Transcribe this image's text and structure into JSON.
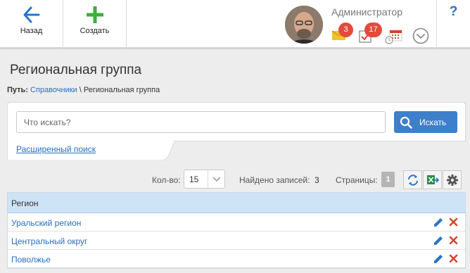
{
  "toolbar": {
    "back_label": "Назад",
    "create_label": "Создать",
    "username": "Администратор",
    "messages_count": "3",
    "tasks_count": "17",
    "help_label": "?"
  },
  "page": {
    "title": "Региональная группа"
  },
  "breadcrumb": {
    "prefix": "Путь:",
    "link": "Справочники",
    "separator": "\\",
    "current": "Региональная группа"
  },
  "search": {
    "placeholder": "Что искать?",
    "button_label": "Искать",
    "advanced_label": "Расширенный поиск"
  },
  "list_controls": {
    "qty_label": "Кол-во:",
    "qty_value": "15",
    "found_label": "Найдено записей:",
    "found_value": "3",
    "pages_label": "Страницы:",
    "current_page": "1"
  },
  "table": {
    "header": "Регион",
    "rows": [
      "Уральский регион",
      "Центральный округ",
      "Поволжье"
    ]
  },
  "colors": {
    "accent_blue": "#3d7fcb",
    "link_blue": "#2a6ebb",
    "create_green": "#3cae3c",
    "badge_red": "#e24b3c",
    "header_blue": "#cfe3f7"
  }
}
